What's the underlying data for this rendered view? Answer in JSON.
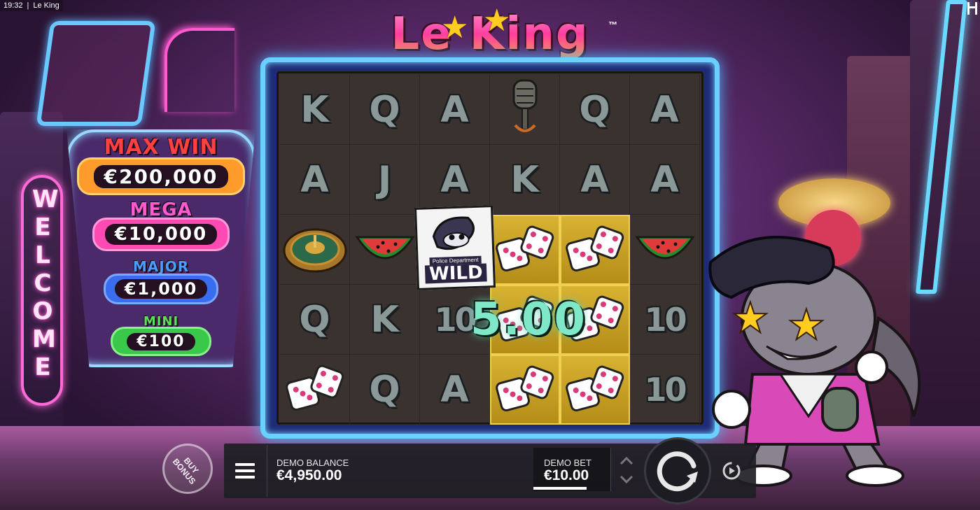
{
  "statusbar": {
    "time": "19:32",
    "separator": "|",
    "app_title": "Le King"
  },
  "game": {
    "logo_text": "Le King",
    "logo_trademark": "™",
    "welcome_sign": "WELCOME"
  },
  "jackpots": [
    {
      "name": "MAX WIN",
      "amount": "€200,000",
      "color": "#ff9b2a"
    },
    {
      "name": "MEGA",
      "amount": "€10,000",
      "color": "#ff4ab4"
    },
    {
      "name": "MAJOR",
      "amount": "€1,000",
      "color": "#3a6cf0"
    },
    {
      "name": "MINI",
      "amount": "€100",
      "color": "#3ac84a"
    }
  ],
  "reels": {
    "grid": [
      [
        "K",
        "Q",
        "A",
        "microphone",
        "Q",
        "A"
      ],
      [
        "A",
        "J",
        "A",
        "K",
        "A",
        "A"
      ],
      [
        "roulette",
        "watermelon",
        "wild",
        "dice",
        "dice",
        "watermelon"
      ],
      [
        "Q",
        "K",
        "10",
        "dice",
        "dice",
        "10"
      ],
      [
        "dice",
        "Q",
        "A",
        "dice",
        "dice",
        "10"
      ]
    ],
    "winning_cells": [
      "2-3",
      "2-4",
      "3-3",
      "3-4",
      "4-3",
      "4-4"
    ],
    "wild_label": "WILD",
    "wild_caption": "Police Department",
    "win_amount": "5.00"
  },
  "controls": {
    "buy_bonus_label": "BUY\nBONUS",
    "menu_icon": "menu-icon",
    "balance_label": "DEMO BALANCE",
    "balance_value": "€4,950.00",
    "bet_label": "DEMO BET",
    "bet_value": "€10.00",
    "spin_icon": "spin-icon",
    "autoplay_icon": "autoplay-icon"
  },
  "colors": {
    "frame_glow": "#6ad0ff",
    "win_cell": "#d8b232",
    "win_text": "#7ee8c8",
    "logo_pink": "#ff3fa0"
  }
}
